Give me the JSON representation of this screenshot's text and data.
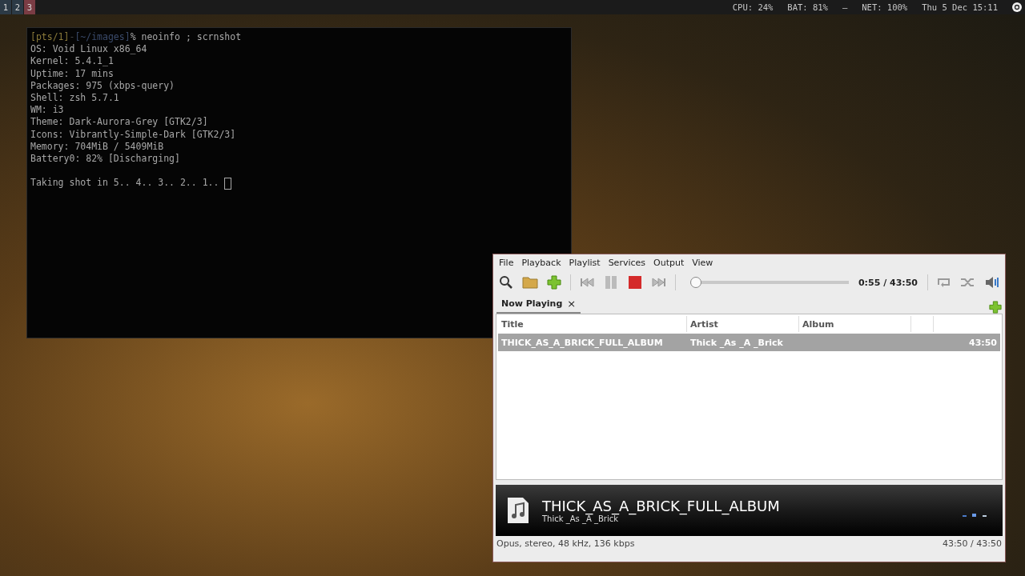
{
  "top_bar": {
    "workspaces": [
      {
        "label": "1",
        "selected": false
      },
      {
        "label": "2",
        "selected": false
      },
      {
        "label": "3",
        "selected": true
      }
    ],
    "status": [
      "CPU: 24%",
      "BAT: 81%",
      "–",
      "NET: 100%",
      "Thu  5 Dec 15:11"
    ]
  },
  "terminal": {
    "prompt": {
      "tty": "[pts/1]",
      "separator": "-",
      "cwd": "[~/images]",
      "command": "% neoinfo ; scrnshot"
    },
    "lines": [
      "OS: Void Linux x86_64",
      "Kernel: 5.4.1_1",
      "Uptime: 17 mins",
      "Packages: 975 (xbps-query)",
      "Shell: zsh 5.7.1",
      "WM: i3",
      "Theme: Dark-Aurora-Grey [GTK2/3]",
      "Icons: Vibrantly-Simple-Dark [GTK2/3]",
      "Memory: 704MiB / 5409MiB",
      "Battery0: 82% [Discharging]"
    ],
    "countdown": "Taking shot in 5.. 4.. 3.. 2.. 1.."
  },
  "player": {
    "menu": [
      "File",
      "Playback",
      "Playlist",
      "Services",
      "Output",
      "View"
    ],
    "seek": {
      "level": 0.035,
      "time": "0:55 / 43:50"
    },
    "tabs": [
      {
        "label": "Now Playing",
        "selected": true,
        "close": "×"
      }
    ],
    "playlist": {
      "columns": [
        "Title",
        "Artist",
        "Album"
      ],
      "rows": [
        {
          "title": "THICK_AS_A_BRICK_FULL_ALBUM",
          "artist": "Thick _As _A _Brick",
          "length": "43:50",
          "selected": true
        }
      ]
    },
    "now_playing": {
      "title": "THICK_AS_A_BRICK_FULL_ALBUM",
      "artist": "Thick _As _A _Brick"
    },
    "status_bar": {
      "format": "Opus, stereo, 48 kHz, 136 kbps",
      "time": "43:50 / 43:50"
    }
  }
}
